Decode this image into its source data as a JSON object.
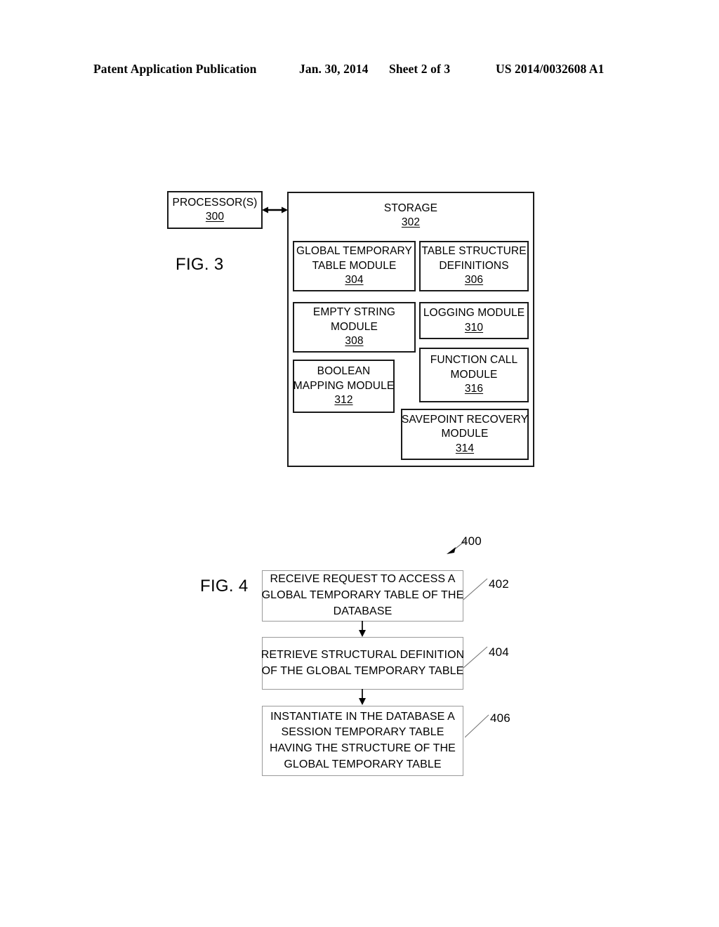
{
  "header": {
    "publication": "Patent Application Publication",
    "date": "Jan. 30, 2014",
    "sheet": "Sheet 2 of 3",
    "patent_number": "US 2014/0032608 A1"
  },
  "figure3": {
    "label": "FIG. 3",
    "processor": {
      "name": "PROCESSOR(S)",
      "ref": "300"
    },
    "storage": {
      "name": "STORAGE",
      "ref": "302"
    },
    "modules": [
      {
        "id": "gtt",
        "lines": [
          "GLOBAL TEMPORARY",
          "TABLE MODULE"
        ],
        "ref": "304"
      },
      {
        "id": "tsd",
        "lines": [
          "TABLE STRUCTURE",
          "DEFINITIONS"
        ],
        "ref": "306"
      },
      {
        "id": "empty",
        "lines": [
          "EMPTY STRING",
          "MODULE"
        ],
        "ref": "308"
      },
      {
        "id": "logging",
        "lines": [
          "LOGGING MODULE"
        ],
        "ref": "310"
      },
      {
        "id": "boolean",
        "lines": [
          "BOOLEAN",
          "MAPPING MODULE"
        ],
        "ref": "312"
      },
      {
        "id": "funccall",
        "lines": [
          "FUNCTION CALL",
          "MODULE"
        ],
        "ref": "316"
      },
      {
        "id": "savepoint",
        "lines": [
          "SAVEPOINT RECOVERY",
          "MODULE"
        ],
        "ref": "314"
      }
    ]
  },
  "figure4": {
    "label": "FIG. 4",
    "flow_ref": "400",
    "steps": [
      {
        "ref": "402",
        "lines": [
          "RECEIVE REQUEST TO ACCESS A",
          "GLOBAL TEMPORARY TABLE OF THE",
          "DATABASE"
        ]
      },
      {
        "ref": "404",
        "lines": [
          "RETRIEVE STRUCTURAL DEFINITION",
          "OF THE GLOBAL TEMPORARY TABLE"
        ]
      },
      {
        "ref": "406",
        "lines": [
          "INSTANTIATE IN THE DATABASE A",
          "SESSION TEMPORARY TABLE",
          "HAVING THE STRUCTURE OF THE",
          "GLOBAL TEMPORARY TABLE"
        ]
      }
    ]
  },
  "colors": {
    "ink": "#000000",
    "box_stroke": "#1a1a1a",
    "flow_stroke": "#9a9a9a",
    "page_bg": "#ffffff"
  }
}
